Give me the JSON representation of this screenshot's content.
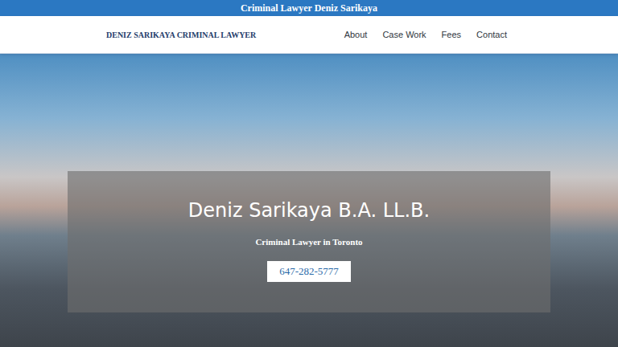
{
  "top_bar": {
    "title": "Criminal Lawyer Deniz Sarikaya"
  },
  "header": {
    "logo": "DENIZ SARIKAYA CRIMINAL LAWYER",
    "nav": [
      {
        "label": "About"
      },
      {
        "label": "Case Work"
      },
      {
        "label": "Fees"
      },
      {
        "label": "Contact"
      }
    ]
  },
  "hero": {
    "title": "Deniz Sarikaya B.A. LL.B.",
    "subtitle": "Criminal Lawyer in Toronto",
    "phone": "647-282-5777"
  }
}
